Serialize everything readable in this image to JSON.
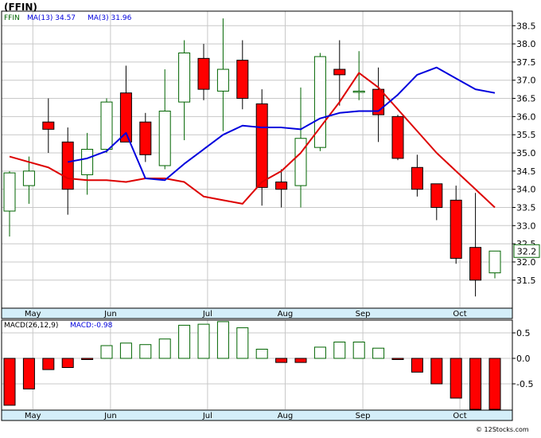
{
  "title": "(FFIN)",
  "watermark": "© 12Stocks.com",
  "colors": {
    "up_fill": "#ffffff",
    "up_stroke": "#006400",
    "down_fill": "#ff0000",
    "down_stroke": "#000000",
    "ma13": "#0000dd",
    "ma3": "#dd0000",
    "frame": "#000000",
    "grid": "#c8c8c8",
    "axis_band": "#d4eef9",
    "hist_pos_stroke": "#006400",
    "hist_neg_fill": "#ff0000",
    "legend_ticker": "#006400",
    "legend_ma13": "#0000dd",
    "legend_ma3": "#0000dd"
  },
  "chart_data": [
    {
      "type": "candlestick",
      "legend": {
        "ticker": "FFIN",
        "ma13": "MA(13)  34.57",
        "ma3": "MA(3)  31.96"
      },
      "last_price_label": "32.2",
      "ylim": [
        30.75,
        38.9
      ],
      "y_ticks": [
        "31.5",
        "32.0",
        "32.5",
        "33.0",
        "33.5",
        "34.0",
        "34.5",
        "35.0",
        "35.5",
        "36.0",
        "36.5",
        "37.0",
        "37.5",
        "38.0",
        "38.5"
      ],
      "x_labels": [
        {
          "label": "May",
          "index": 1.2
        },
        {
          "label": "Jun",
          "index": 5.2
        },
        {
          "label": "Jul",
          "index": 10.2
        },
        {
          "label": "Aug",
          "index": 14.2
        },
        {
          "label": "Sep",
          "index": 18.2
        },
        {
          "label": "Oct",
          "index": 23.2
        }
      ],
      "candles": [
        {
          "o": 33.4,
          "h": 34.5,
          "l": 32.7,
          "c": 34.45
        },
        {
          "o": 34.1,
          "h": 34.9,
          "l": 33.6,
          "c": 34.5
        },
        {
          "o": 35.85,
          "h": 36.5,
          "l": 35.0,
          "c": 35.65
        },
        {
          "o": 35.3,
          "h": 35.7,
          "l": 33.3,
          "c": 34.0
        },
        {
          "o": 34.4,
          "h": 35.55,
          "l": 33.85,
          "c": 35.1
        },
        {
          "o": 35.1,
          "h": 36.5,
          "l": 35.0,
          "c": 36.4
        },
        {
          "o": 36.65,
          "h": 37.4,
          "l": 35.3,
          "c": 35.3
        },
        {
          "o": 35.85,
          "h": 36.1,
          "l": 34.75,
          "c": 34.95
        },
        {
          "o": 34.65,
          "h": 37.3,
          "l": 34.55,
          "c": 36.15
        },
        {
          "o": 36.4,
          "h": 38.1,
          "l": 35.35,
          "c": 37.75
        },
        {
          "o": 37.6,
          "h": 38.0,
          "l": 36.45,
          "c": 36.75
        },
        {
          "o": 36.7,
          "h": 38.7,
          "l": 35.6,
          "c": 37.3
        },
        {
          "o": 37.55,
          "h": 38.1,
          "l": 36.2,
          "c": 36.5
        },
        {
          "o": 36.35,
          "h": 36.75,
          "l": 33.55,
          "c": 34.05
        },
        {
          "o": 34.2,
          "h": 34.55,
          "l": 33.5,
          "c": 34.0
        },
        {
          "o": 34.1,
          "h": 36.8,
          "l": 33.5,
          "c": 35.4
        },
        {
          "o": 35.15,
          "h": 37.75,
          "l": 35.05,
          "c": 37.65
        },
        {
          "o": 37.3,
          "h": 38.1,
          "l": 36.3,
          "c": 37.15
        },
        {
          "o": 36.7,
          "h": 37.8,
          "l": 36.45,
          "c": 36.7
        },
        {
          "o": 36.75,
          "h": 37.35,
          "l": 35.3,
          "c": 36.05
        },
        {
          "o": 36.0,
          "h": 36.05,
          "l": 34.8,
          "c": 34.85
        },
        {
          "o": 34.6,
          "h": 34.95,
          "l": 33.8,
          "c": 34.0
        },
        {
          "o": 34.15,
          "h": 34.15,
          "l": 33.15,
          "c": 33.5
        },
        {
          "o": 33.7,
          "h": 34.1,
          "l": 31.95,
          "c": 32.1
        },
        {
          "o": 32.4,
          "h": 33.9,
          "l": 31.05,
          "c": 31.5
        },
        {
          "o": 31.7,
          "h": 32.3,
          "l": 31.55,
          "c": 32.3
        }
      ],
      "ma13": {
        "start_index": 3,
        "values": [
          34.75,
          34.85,
          35.05,
          35.55,
          34.3,
          34.25,
          34.7,
          35.1,
          35.5,
          35.75,
          35.7,
          35.7,
          35.65,
          35.95,
          36.1,
          36.15,
          36.15,
          36.6,
          37.15,
          37.35,
          37.05,
          36.75,
          36.65
        ]
      },
      "ma3": {
        "start_index": 0,
        "values": [
          34.9,
          34.75,
          34.6,
          34.3,
          34.25,
          34.25,
          34.2,
          34.3,
          34.3,
          34.2,
          33.8,
          33.7,
          33.6,
          34.2,
          34.5,
          35.0,
          35.7,
          36.4,
          37.2,
          36.8,
          36.2,
          35.6,
          35.0,
          34.5,
          34.0,
          33.5
        ]
      }
    },
    {
      "type": "bar",
      "legend": {
        "name": "MACD(26,12,9)",
        "value": "MACD:-0.98"
      },
      "ylim": [
        -1.0,
        0.75
      ],
      "y_ticks": [
        "0.5",
        "0.0",
        "-0.5"
      ],
      "values": [
        -0.92,
        -0.6,
        -0.22,
        -0.18,
        -0.02,
        0.25,
        0.3,
        0.27,
        0.38,
        0.65,
        0.67,
        0.72,
        0.6,
        0.18,
        -0.08,
        -0.08,
        0.22,
        0.32,
        0.32,
        0.2,
        -0.02,
        -0.27,
        -0.5,
        -0.78,
        -1.0,
        -1.0
      ]
    }
  ]
}
